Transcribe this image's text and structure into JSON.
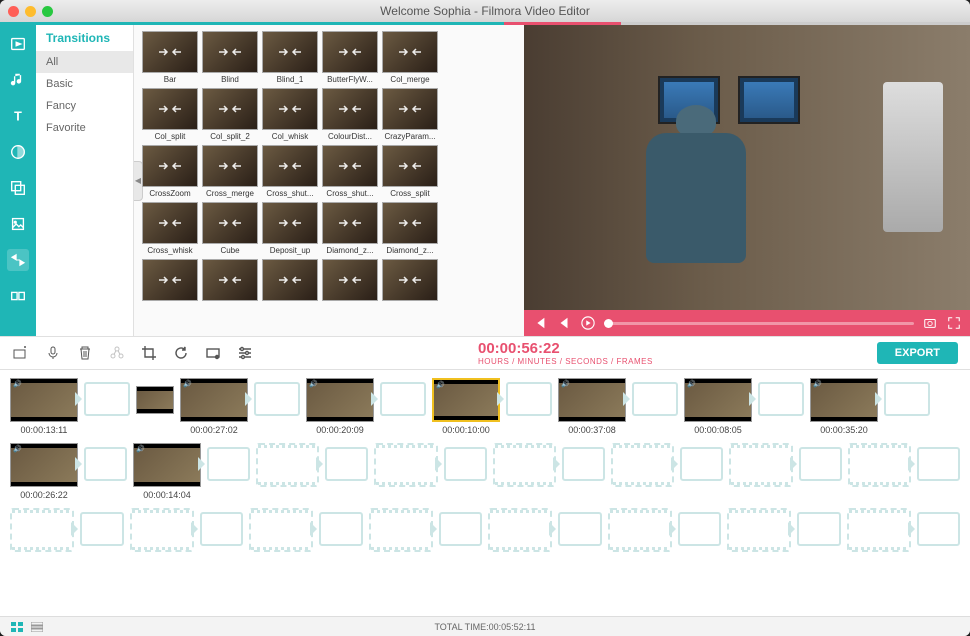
{
  "window": {
    "title": "Welcome Sophia - Filmora Video Editor"
  },
  "leftbar": {
    "items": [
      {
        "name": "media-icon"
      },
      {
        "name": "music-icon"
      },
      {
        "name": "text-icon"
      },
      {
        "name": "filters-icon"
      },
      {
        "name": "overlays-icon"
      },
      {
        "name": "elements-icon"
      },
      {
        "name": "transitions-icon",
        "selected": true
      },
      {
        "name": "split-icon"
      }
    ]
  },
  "categories": {
    "header": "Transitions",
    "items": [
      {
        "label": "All",
        "selected": true
      },
      {
        "label": "Basic"
      },
      {
        "label": "Fancy"
      },
      {
        "label": "Favorite"
      }
    ]
  },
  "transitions": [
    {
      "label": "Bar"
    },
    {
      "label": "Blind"
    },
    {
      "label": "Blind_1"
    },
    {
      "label": "ButterFlyW..."
    },
    {
      "label": "Col_merge"
    },
    {
      "label": "Col_split"
    },
    {
      "label": "Col_split_2"
    },
    {
      "label": "Col_whisk"
    },
    {
      "label": "ColourDist..."
    },
    {
      "label": "CrazyParam..."
    },
    {
      "label": "CrossZoom"
    },
    {
      "label": "Cross_merge"
    },
    {
      "label": "Cross_shut..."
    },
    {
      "label": "Cross_shut..."
    },
    {
      "label": "Cross_split"
    },
    {
      "label": "Cross_whisk"
    },
    {
      "label": "Cube"
    },
    {
      "label": "Deposit_up"
    },
    {
      "label": "Diamond_z..."
    },
    {
      "label": "Diamond_z..."
    }
  ],
  "toolbar": {
    "timecode": "00:00:56:22",
    "timecode_sub": "HOURS / MINUTES / SECONDS / FRAMES",
    "export_label": "EXPORT"
  },
  "timeline": {
    "row1": [
      {
        "time": "00:00:13:11"
      },
      {
        "small": true
      },
      {
        "time": "00:00:27:02"
      },
      {
        "time": "00:00:20:09"
      },
      {
        "time": "00:00:10:00",
        "selected": true
      },
      {
        "time": "00:00:37:08"
      },
      {
        "time": "00:00:08:05"
      },
      {
        "time": "00:00:35:20"
      }
    ],
    "row2": [
      {
        "time": "00:00:26:22"
      },
      {
        "time": "00:00:14:04"
      }
    ]
  },
  "footer": {
    "total": "TOTAL TIME:00:05:52:11"
  }
}
